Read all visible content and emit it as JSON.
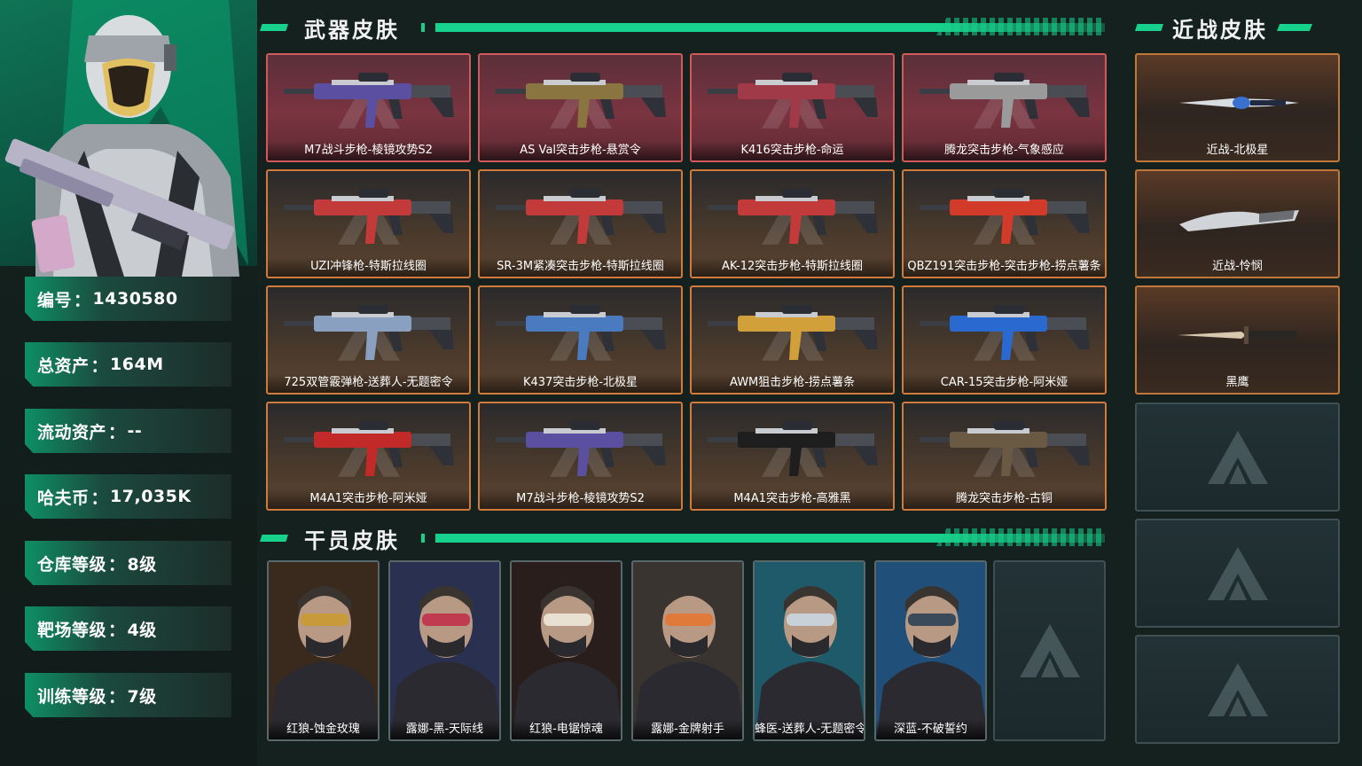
{
  "profile": {
    "stats": [
      {
        "label": "编号",
        "value": "1430580"
      },
      {
        "label": "总资产",
        "value": "164M"
      },
      {
        "label": "流动资产",
        "value": "--"
      },
      {
        "label": "哈夫币",
        "value": "17,035K"
      },
      {
        "label": "仓库等级",
        "value": "8级"
      },
      {
        "label": "靶场等级",
        "value": "4级"
      },
      {
        "label": "训练等级",
        "value": "7级"
      }
    ],
    "separator": "："
  },
  "sections": {
    "weapons_title": "武器皮肤",
    "melee_title": "近战皮肤",
    "operators_title": "干员皮肤"
  },
  "weapons": [
    {
      "name": "M7战斗步枪-棱镜攻势S2",
      "tier": "red",
      "accent": "#5a4fa0"
    },
    {
      "name": "AS Val突击步枪-悬赏令",
      "tier": "red",
      "accent": "#8a7440"
    },
    {
      "name": "K416突击步枪-命运",
      "tier": "red",
      "accent": "#a03a48"
    },
    {
      "name": "腾龙突击步枪-气象感应",
      "tier": "red",
      "accent": "#9a9a9a"
    },
    {
      "name": "UZI冲锋枪-特斯拉线圈",
      "tier": "gold",
      "accent": "#c23a3a"
    },
    {
      "name": "SR-3M紧凑突击步枪-特斯拉线圈",
      "tier": "gold",
      "accent": "#c23a3a"
    },
    {
      "name": "AK-12突击步枪-特斯拉线圈",
      "tier": "gold",
      "accent": "#c23a3a"
    },
    {
      "name": "QBZ191突击步枪-突击步枪-捞点薯条",
      "tier": "gold",
      "accent": "#d23a2a"
    },
    {
      "name": "725双管霰弹枪-送葬人-无题密令",
      "tier": "gold",
      "accent": "#8aa0c0"
    },
    {
      "name": "K437突击步枪-北极星",
      "tier": "gold",
      "accent": "#4a7ac0"
    },
    {
      "name": "AWM狙击步枪-捞点薯条",
      "tier": "gold",
      "accent": "#d2a03a"
    },
    {
      "name": "CAR-15突击步枪-阿米娅",
      "tier": "gold",
      "accent": "#2a6ad0"
    },
    {
      "name": "M4A1突击步枪-阿米娅",
      "tier": "gold",
      "accent": "#c22a2a"
    },
    {
      "name": "M7战斗步枪-棱镜攻势S2",
      "tier": "gold",
      "accent": "#5a4fa0"
    },
    {
      "name": "M4A1突击步枪-高雅黑",
      "tier": "gold",
      "accent": "#1e1e1e"
    },
    {
      "name": "腾龙突击步枪-古铜",
      "tier": "gold",
      "accent": "#6a5a44"
    }
  ],
  "melee": [
    {
      "name": "近战-北极星",
      "accent": "#3a70d0"
    },
    {
      "name": "近战-怜悯",
      "accent": "#c8c8c8"
    },
    {
      "name": "黑鹰",
      "accent": "#d0b89a"
    }
  ],
  "operators": [
    {
      "name": "红狼-蚀金玫瑰",
      "bg": "#3a2a1e",
      "accent": "#c89a3a"
    },
    {
      "name": "露娜-黑-天际线",
      "bg": "#2a3050",
      "accent": "#c03a50"
    },
    {
      "name": "红狼-电锯惊魂",
      "bg": "#2a1e1c",
      "accent": "#e8e0d0"
    },
    {
      "name": "露娜-金牌射手",
      "bg": "#3a3430",
      "accent": "#e07a3a"
    },
    {
      "name": "蜂医-送葬人-无题密令",
      "bg": "#1e5a6a",
      "accent": "#c8d0d8"
    },
    {
      "name": "深蓝-不破誓约",
      "bg": "#20507a",
      "accent": "#3a4a5a"
    }
  ]
}
